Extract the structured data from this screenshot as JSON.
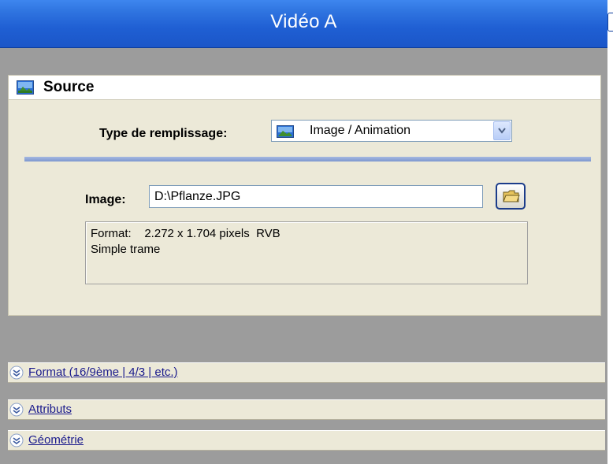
{
  "window": {
    "title": "Vidéo A"
  },
  "source": {
    "header": "Source",
    "fill_type_label": "Type de remplissage:",
    "fill_type_value": "Image / Animation",
    "image_label": "Image:",
    "image_path": "D:\\Pflanze.JPG",
    "info": {
      "line1": "Format:    2.272 x 1.704 pixels  RVB",
      "line2": "Simple trame"
    }
  },
  "sections": [
    {
      "label": "Format (16/9ème | 4/3 | etc.)"
    },
    {
      "label": "Attributs"
    },
    {
      "label": "Géométrie"
    }
  ],
  "colors": {
    "title_bar": "#1f5fd3",
    "panel_bg": "#ece9d8",
    "workspace_bg": "#9c9c9c",
    "link_text": "#1a1a8c"
  }
}
